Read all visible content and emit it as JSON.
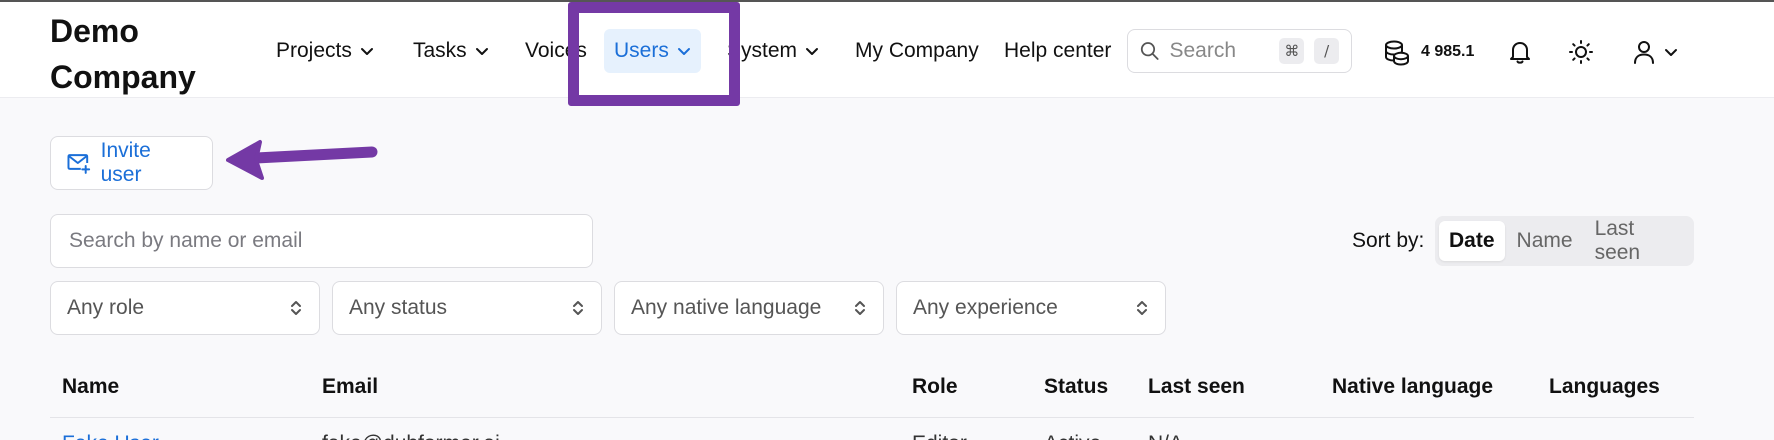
{
  "app": {
    "name": "Demo Company"
  },
  "nav": {
    "items": [
      {
        "label": "Projects",
        "has_menu": true
      },
      {
        "label": "Tasks",
        "has_menu": true
      },
      {
        "label": "Voices",
        "has_menu": false
      },
      {
        "label": "Users",
        "has_menu": true,
        "active": true
      },
      {
        "label": "System",
        "has_menu": true
      },
      {
        "label": "My Company",
        "has_menu": false
      },
      {
        "label": "Help center",
        "has_menu": false
      }
    ]
  },
  "search": {
    "placeholder": "Search",
    "shortcut_key1": "⌘",
    "shortcut_key2": "/"
  },
  "credits": {
    "value": "4 985.1"
  },
  "icons": {
    "search": "search-icon",
    "credits": "coins-icon",
    "notifications": "bell-icon",
    "theme": "sun-icon",
    "user": "user-icon",
    "invite": "mail-plus-icon",
    "chevron": "chevron-down-icon",
    "select": "chevron-up-down-icon"
  },
  "toolbar": {
    "invite_label": "Invite user"
  },
  "filters": {
    "search_placeholder": "Search by name or email",
    "role": "Any role",
    "status": "Any status",
    "native_language": "Any native language",
    "experience": "Any experience"
  },
  "sort": {
    "label": "Sort by:",
    "options": [
      "Date",
      "Name",
      "Last seen"
    ],
    "selected": "Date"
  },
  "table": {
    "headers": [
      "Name",
      "Email",
      "Role",
      "Status",
      "Last seen",
      "Native language",
      "Languages"
    ],
    "rows": [
      {
        "name": "Fake User",
        "email": "fake@dubformer.ai",
        "role": "Editor",
        "status": "Active",
        "last_seen": "N/A"
      }
    ]
  },
  "colors": {
    "accent": "#1b6fd8",
    "active_bg": "#e6f1fd",
    "annotation": "#7439a5",
    "page_bg": "#f9f9fb"
  }
}
